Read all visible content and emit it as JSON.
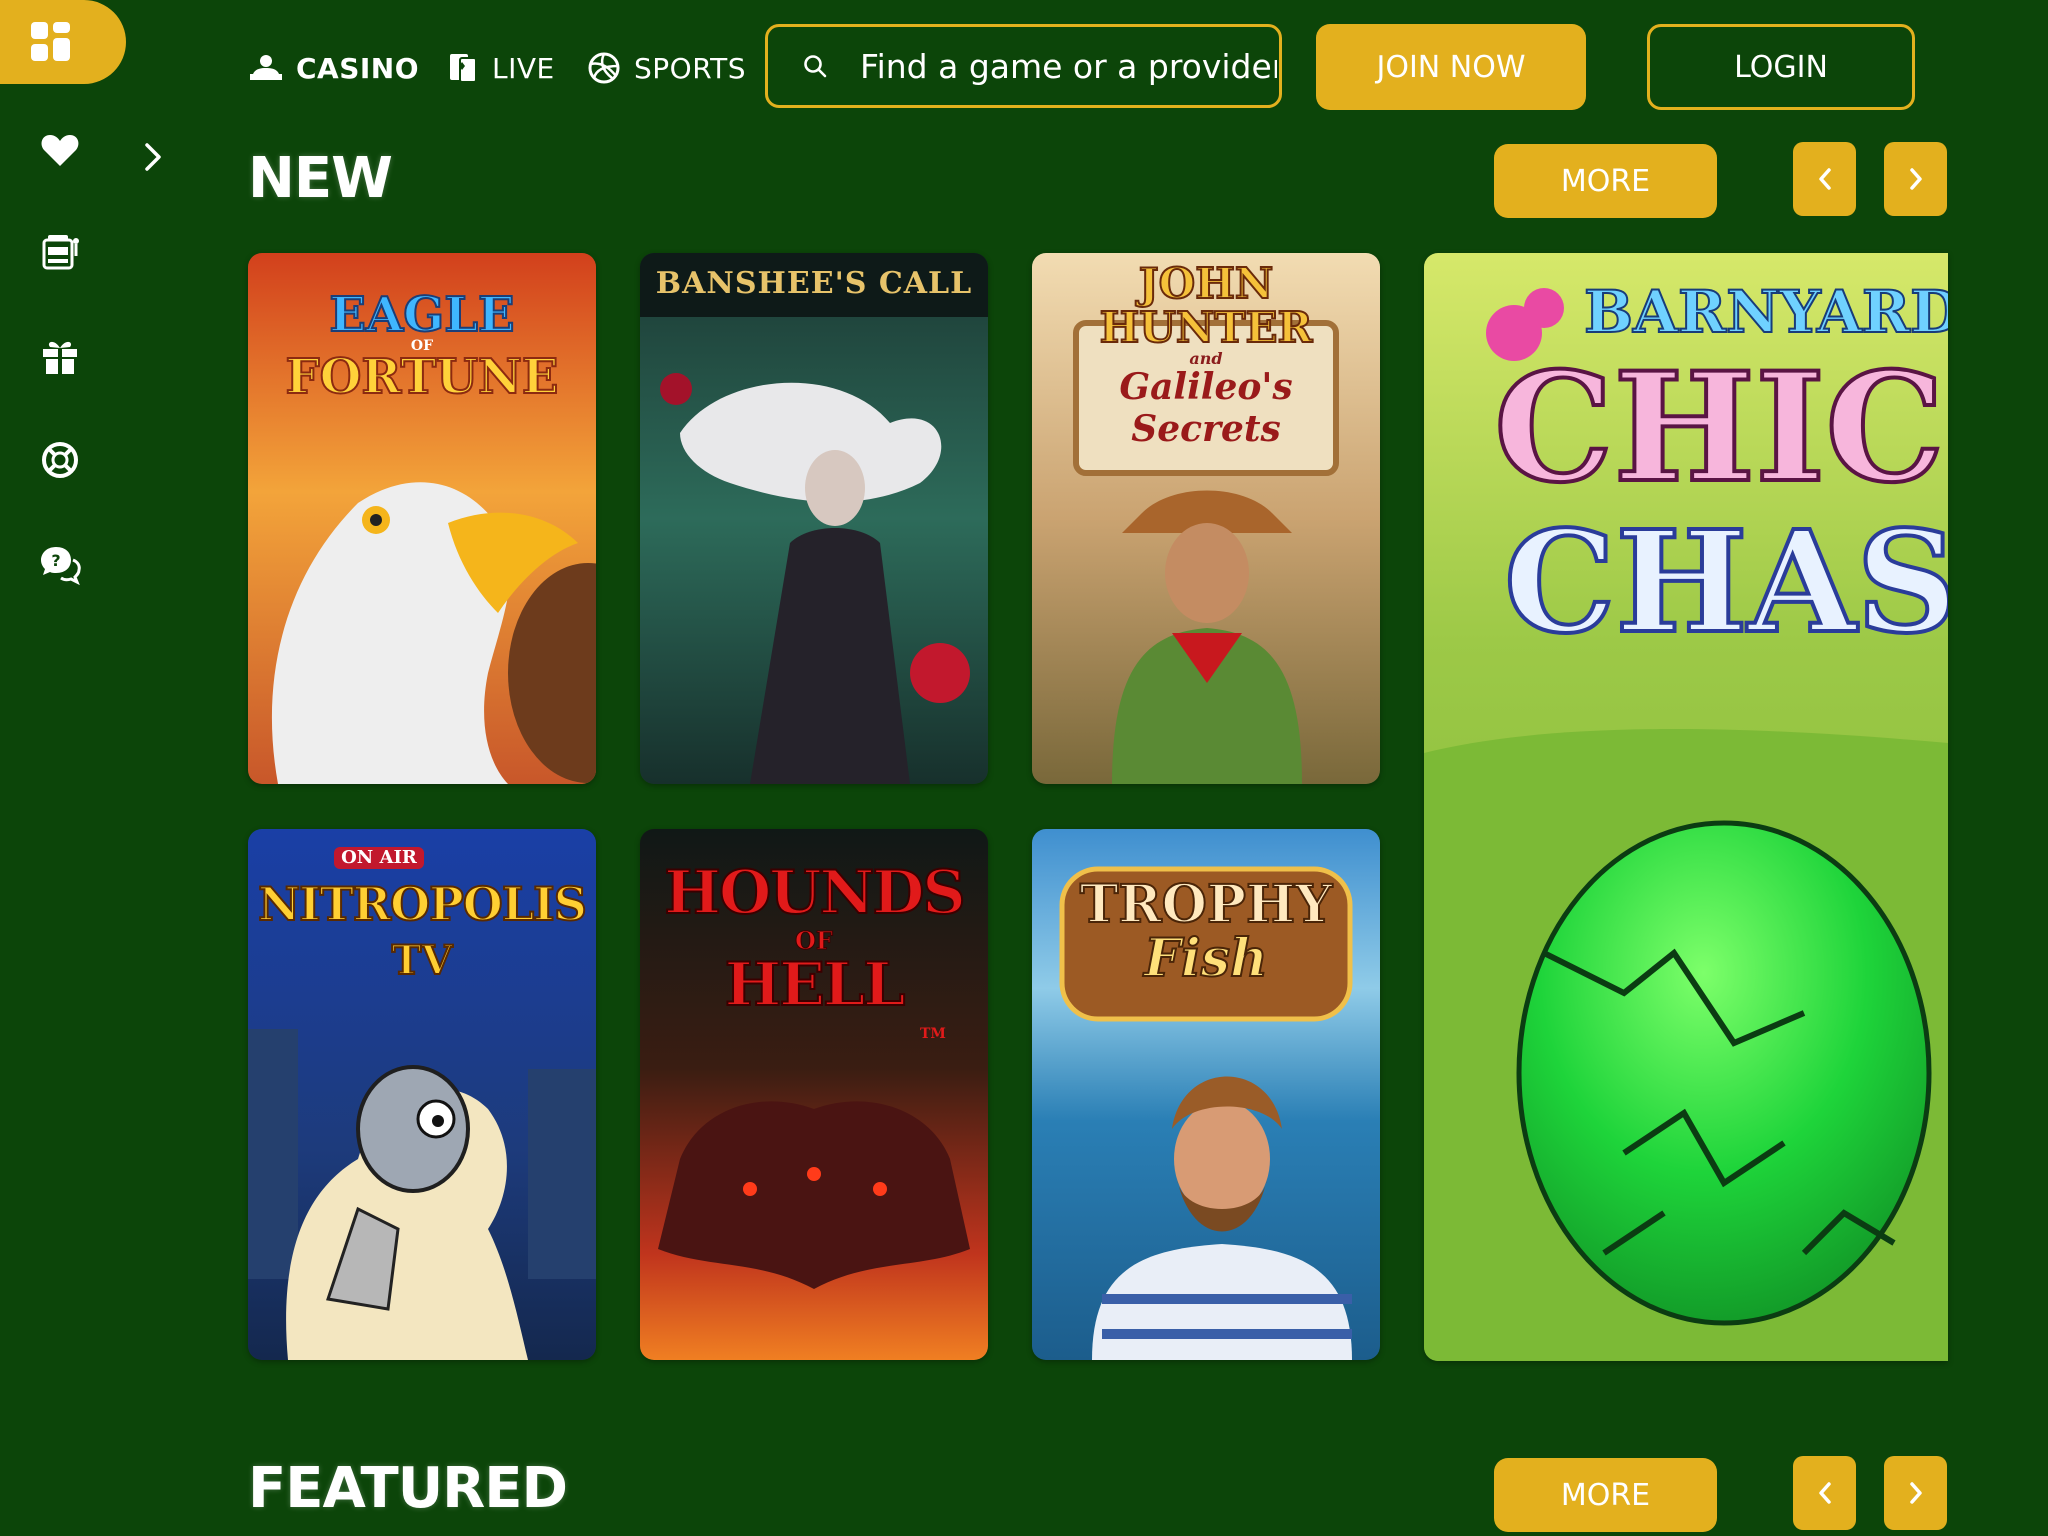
{
  "nav": {
    "casino": "CASINO",
    "live": "LIVE",
    "sports": "SPORTS",
    "search_placeholder": "Find a game or a provider",
    "join": "JOIN NOW",
    "login": "LOGIN"
  },
  "sections": {
    "new": {
      "title": "NEW",
      "more": "MORE"
    },
    "featured": {
      "title": "FEATURED",
      "more": "MORE"
    }
  },
  "games": {
    "eagle": {
      "title": "EAGLE",
      "sub": "OF",
      "title2": "FORTUNE"
    },
    "banshee": {
      "title": "BANSHEE'S CALL"
    },
    "john": {
      "title": "JOHN",
      "title2": "HUNTER",
      "sub": "and",
      "title3": "Galileo's",
      "title4": "Secrets"
    },
    "barnyard": {
      "title": "BARNYARD",
      "title2": "CHICK",
      "title3": "CHAS"
    },
    "nitropolis": {
      "tag": "ON AIR",
      "title": "NITROPOLIS",
      "title2": "TV"
    },
    "hounds": {
      "title": "HOUNDS",
      "sub": "OF",
      "title2": "HELL",
      "tm": "TM"
    },
    "trophy": {
      "title": "TROPHY",
      "title2": "Fish"
    }
  },
  "colors": {
    "bg": "#0c4509",
    "accent": "#e3b01e"
  }
}
